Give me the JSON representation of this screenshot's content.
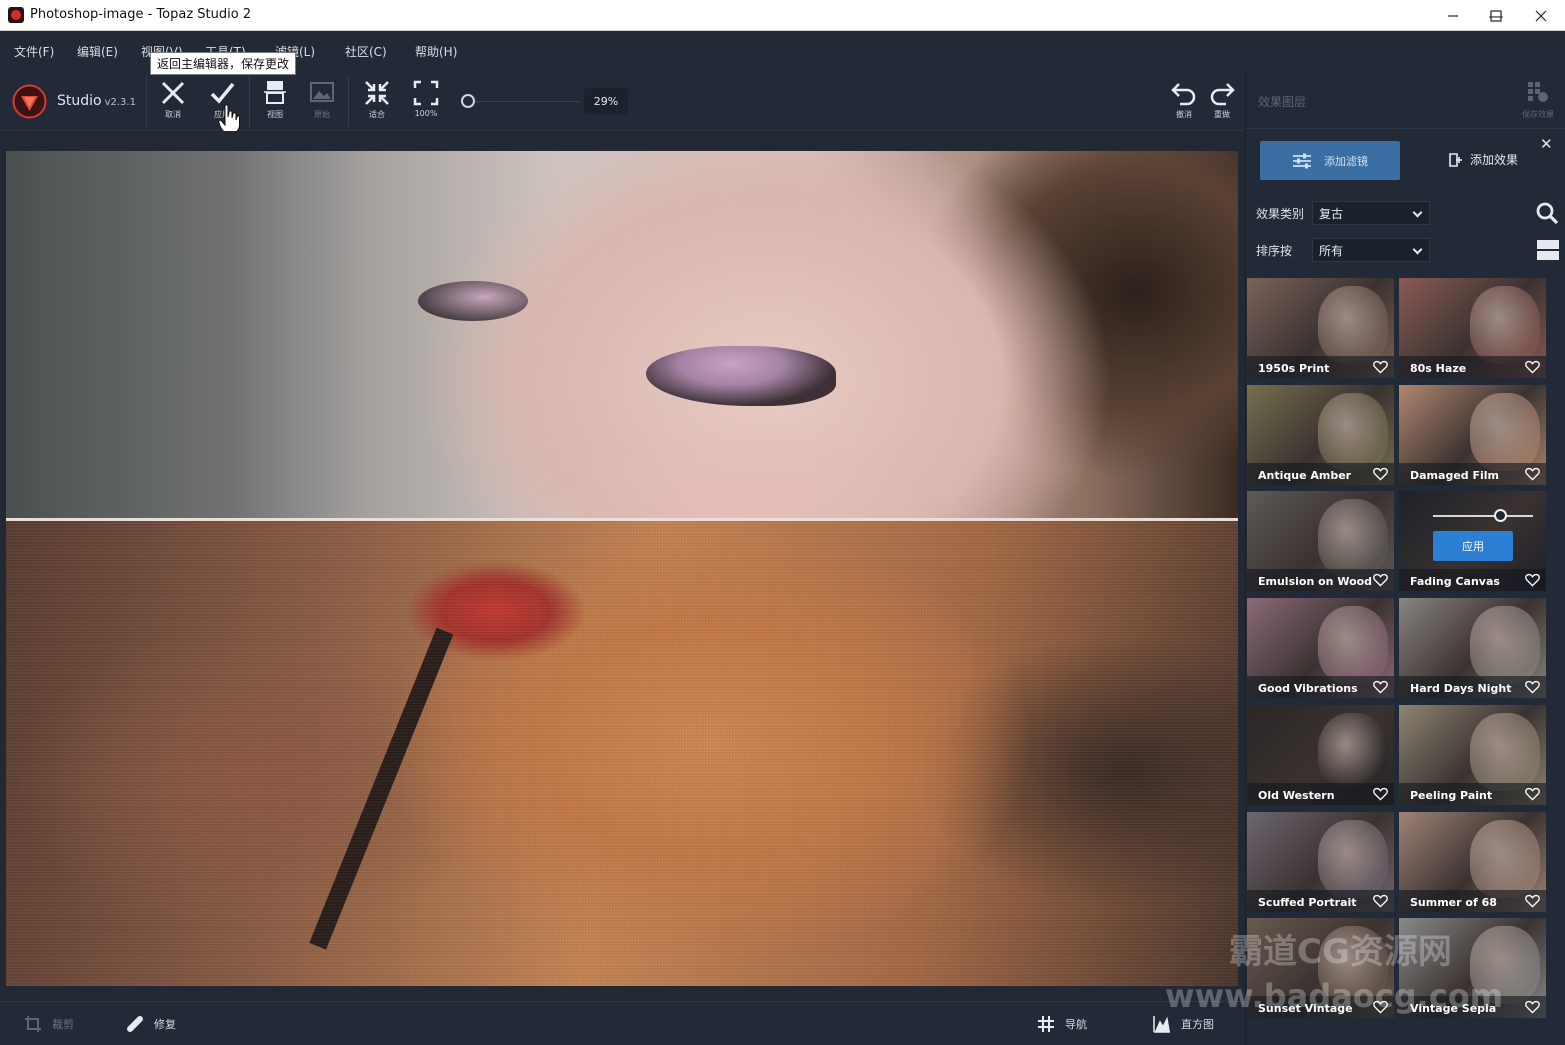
{
  "window": {
    "title": "Photoshop-image - Topaz Studio 2",
    "minimize": "—",
    "maximize": "☐",
    "close": "✕"
  },
  "menu": [
    "文件(F)",
    "编辑(E)",
    "视图(V)",
    "工具(T)",
    "滤镜(L)",
    "社区(C)",
    "帮助(H)"
  ],
  "toolbar": {
    "app_name": "Studio",
    "version": "v2.3.1",
    "cancel": "取消",
    "apply": "应用",
    "view": "视图",
    "compare": "原始",
    "fit": "适合",
    "actual": "100%",
    "zoom_value": "29%",
    "undo": "撤消",
    "redo": "重做",
    "tooltip": "返回主编辑器，保存更改"
  },
  "bottom_bar": {
    "crop": "裁剪",
    "repair": "修复",
    "navigate": "导航",
    "histogram": "直方图"
  },
  "panel": {
    "title": "效果图层",
    "save_effect": "保存效果",
    "add_filter": "添加滤镜",
    "add_effect": "添加效果",
    "category_label": "效果类别",
    "category_value": "复古",
    "sort_label": "排序按",
    "sort_value": "所有",
    "apply_button": "应用"
  },
  "effects": [
    {
      "name": "1950s Print",
      "tint": "#7a6258"
    },
    {
      "name": "80s Haze",
      "tint": "#8a5a55"
    },
    {
      "name": "Antique Amber",
      "tint": "#76704f"
    },
    {
      "name": "Damaged Film",
      "tint": "#b08770"
    },
    {
      "name": "Emulsion on Wood",
      "tint": "#5e5a57"
    },
    {
      "name": "Fading Canvas",
      "tint": "#1c2128"
    },
    {
      "name": "Good Vibrations",
      "tint": "#8c6a78"
    },
    {
      "name": "Hard Days Night",
      "tint": "#8a8580"
    },
    {
      "name": "Old Western",
      "tint": "#2a2726"
    },
    {
      "name": "Peeling Paint",
      "tint": "#8e8572"
    },
    {
      "name": "Scuffed Portrait",
      "tint": "#6e6670"
    },
    {
      "name": "Summer of 68",
      "tint": "#a08478"
    },
    {
      "name": "Sunset Vintage",
      "tint": "#6a5a4e"
    },
    {
      "name": "Vintage Sepia",
      "tint": "#8a8a88"
    }
  ],
  "watermark": {
    "line1": "霸道CG资源网",
    "line2": "www.badaocg.com"
  }
}
